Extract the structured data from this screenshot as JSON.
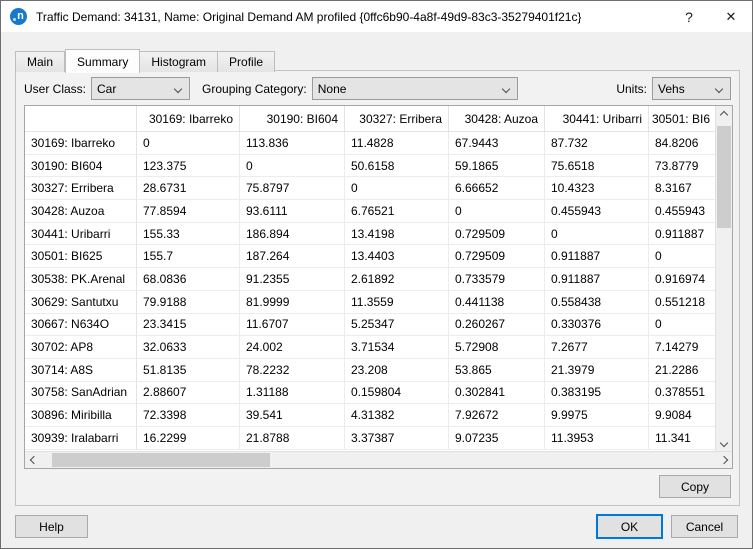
{
  "window": {
    "title": "Traffic Demand: 34131, Name: Original Demand AM profiled {0ffc6b90-4a8f-49d9-83c3-35279401f21c}",
    "help_glyph": "?",
    "close_glyph": "✕",
    "logo_letter": "n"
  },
  "tabs": [
    {
      "label": "Main",
      "active": false
    },
    {
      "label": "Summary",
      "active": true
    },
    {
      "label": "Histogram",
      "active": false
    },
    {
      "label": "Profile",
      "active": false
    }
  ],
  "controls": {
    "user_class_label": "User Class:",
    "user_class_value": "Car",
    "grouping_label": "Grouping Category:",
    "grouping_value": "None",
    "units_label": "Units:",
    "units_value": "Vehs"
  },
  "chart_data": {
    "type": "table",
    "title": "OD matrix summary (Vehs)",
    "columns": [
      "30169: Ibarreko",
      "30190: BI604",
      "30327: Erribera",
      "30428: Auzoa",
      "30441: Uribarri",
      "30501: BI6"
    ],
    "rows": [
      {
        "name": "30169: Ibarreko",
        "values": [
          "0",
          "113.836",
          "11.4828",
          "67.9443",
          "87.732",
          "84.8206"
        ]
      },
      {
        "name": "30190: BI604",
        "values": [
          "123.375",
          "0",
          "50.6158",
          "59.1865",
          "75.6518",
          "73.8779"
        ]
      },
      {
        "name": "30327: Erribera",
        "values": [
          "28.6731",
          "75.8797",
          "0",
          "6.66652",
          "10.4323",
          "8.3167"
        ]
      },
      {
        "name": "30428: Auzoa",
        "values": [
          "77.8594",
          "93.6111",
          "6.76521",
          "0",
          "0.455943",
          "0.455943"
        ]
      },
      {
        "name": "30441: Uribarri",
        "values": [
          "155.33",
          "186.894",
          "13.4198",
          "0.729509",
          "0",
          "0.911887"
        ]
      },
      {
        "name": "30501: BI625",
        "values": [
          "155.7",
          "187.264",
          "13.4403",
          "0.729509",
          "0.911887",
          "0"
        ]
      },
      {
        "name": "30538: PK.Arenal",
        "values": [
          "68.0836",
          "91.2355",
          "2.61892",
          "0.733579",
          "0.911887",
          "0.916974"
        ]
      },
      {
        "name": "30629: Santutxu",
        "values": [
          "79.9188",
          "81.9999",
          "11.3559",
          "0.441138",
          "0.558438",
          "0.551218"
        ]
      },
      {
        "name": "30667: N634O",
        "values": [
          "23.3415",
          "11.6707",
          "5.25347",
          "0.260267",
          "0.330376",
          "0"
        ]
      },
      {
        "name": "30702: AP8",
        "values": [
          "32.0633",
          "24.002",
          "3.71534",
          "5.72908",
          "7.2677",
          "7.14279"
        ]
      },
      {
        "name": "30714: A8S",
        "values": [
          "51.8135",
          "78.2232",
          "23.208",
          "53.865",
          "21.3979",
          "21.2286"
        ]
      },
      {
        "name": "30758: SanAdrian",
        "values": [
          "2.88607",
          "1.31188",
          "0.159804",
          "0.302841",
          "0.383195",
          "0.378551"
        ]
      },
      {
        "name": "30896: Miribilla",
        "values": [
          "72.3398",
          "39.541",
          "4.31382",
          "7.92672",
          "9.9975",
          "9.9084"
        ]
      },
      {
        "name": "30939: Iralabarri",
        "values": [
          "16.2299",
          "21.8788",
          "3.37387",
          "9.07235",
          "11.3953",
          "11.341"
        ]
      }
    ]
  },
  "buttons": {
    "copy": "Copy",
    "help": "Help",
    "ok": "OK",
    "cancel": "Cancel"
  },
  "colors": {
    "accent": "#0078d7",
    "logo_blue": "#1679d0"
  }
}
